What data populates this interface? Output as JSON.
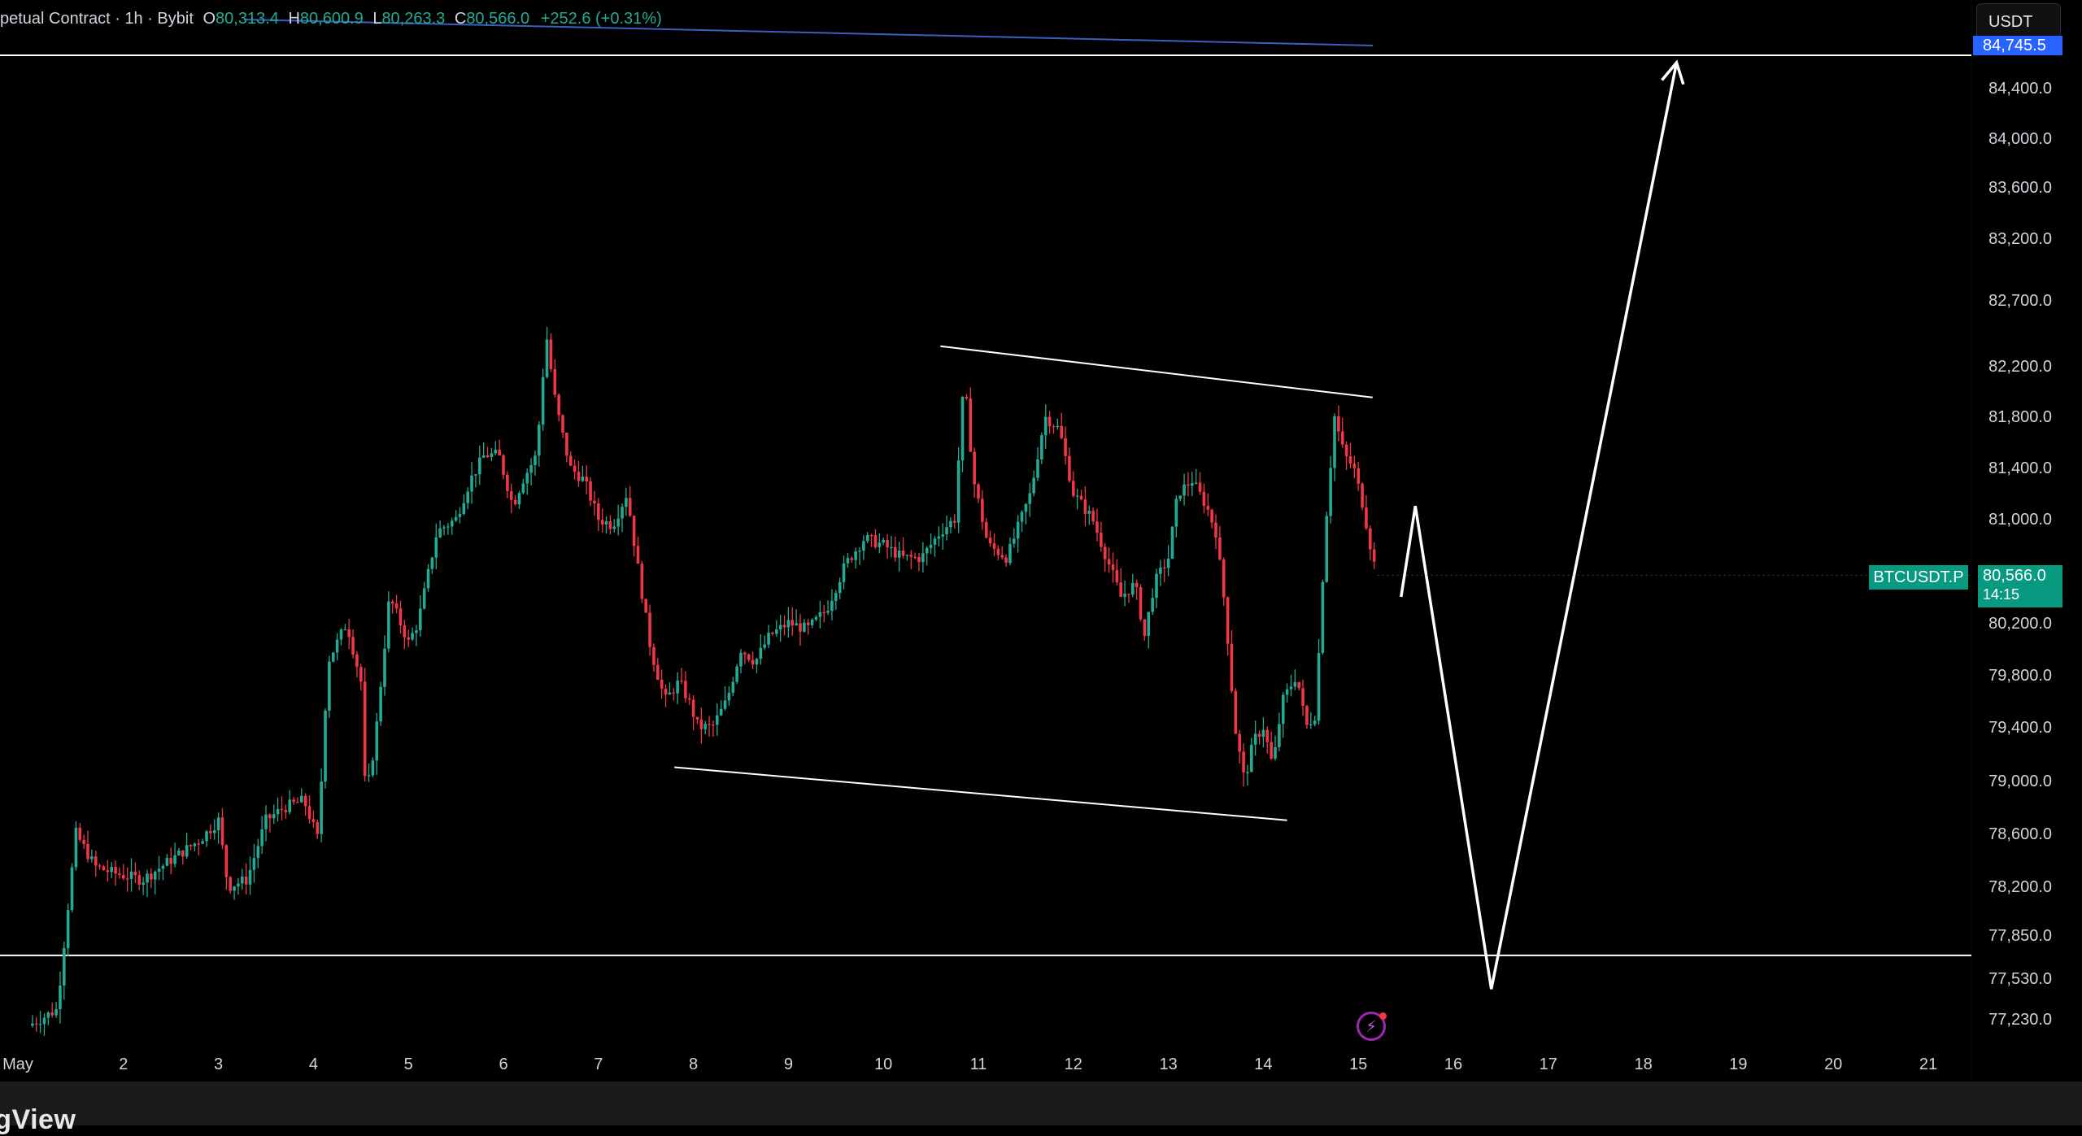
{
  "header": {
    "symbol_text": "petual Contract · 1h · Bybit",
    "open_label": "O",
    "open": "80,313.4",
    "high_label": "H",
    "high": "80,600.9",
    "low_label": "L",
    "low": "80,263.3",
    "close_label": "C",
    "close": "80,566.0",
    "change": "+252.6 (+0.31%)"
  },
  "unit_button": "USDT",
  "symbol_tag": "BTCUSDT.P",
  "last_price": "80,566.0",
  "countdown": "14:15",
  "top_price_tag": "84,745.5",
  "brand": "ngView",
  "colors": {
    "background": "#000000",
    "up": "#22ab94",
    "down": "#f23645",
    "drawing": "#ffffff",
    "ma_line": "#3a5fbf",
    "price_tag": "#089981",
    "alert_tag": "#2962ff"
  },
  "icons": {
    "alert": "lightning-bolt-icon"
  },
  "chart_data": {
    "type": "candlestick",
    "interval": "1h",
    "title": "",
    "xlabel": "",
    "ylabel": "",
    "x_ticks": [
      "May",
      "2",
      "3",
      "4",
      "5",
      "6",
      "7",
      "8",
      "9",
      "10",
      "11",
      "12",
      "13",
      "14",
      "15",
      "16",
      "17",
      "18",
      "19",
      "20",
      "21"
    ],
    "y_ticks": [
      84400,
      84000,
      83600,
      83200,
      82700,
      82200,
      81800,
      81400,
      81000,
      80200,
      79800,
      79400,
      79000,
      78600,
      78200,
      77850,
      77530,
      77230
    ],
    "y_tick_labels": [
      "84,400.0",
      "84,000.0",
      "83,600.0",
      "83,200.0",
      "82,700.0",
      "82,200.0",
      "81,800.0",
      "81,400.0",
      "81,000.0",
      "80,200.0",
      "79,800.0",
      "79,400.0",
      "79,000.0",
      "78,600.0",
      "78,200.0",
      "77,850.0",
      "77,530.0",
      "77,230.0"
    ],
    "ylim": [
      77000,
      84800
    ],
    "price_path": [
      [
        1.0,
        77180
      ],
      [
        1.3,
        77300
      ],
      [
        1.5,
        78600
      ],
      [
        1.7,
        78350
      ],
      [
        1.9,
        78300
      ],
      [
        2.2,
        78250
      ],
      [
        2.5,
        78400
      ],
      [
        2.8,
        78550
      ],
      [
        3.0,
        78700
      ],
      [
        3.1,
        78200
      ],
      [
        3.3,
        78250
      ],
      [
        3.5,
        78700
      ],
      [
        3.7,
        78800
      ],
      [
        3.9,
        78850
      ],
      [
        4.05,
        78550
      ],
      [
        4.15,
        79900
      ],
      [
        4.35,
        80200
      ],
      [
        4.5,
        79750
      ],
      [
        4.55,
        78850
      ],
      [
        4.65,
        79300
      ],
      [
        4.8,
        80400
      ],
      [
        5.0,
        80050
      ],
      [
        5.1,
        80200
      ],
      [
        5.3,
        80900
      ],
      [
        5.5,
        81000
      ],
      [
        5.65,
        81300
      ],
      [
        5.8,
        81500
      ],
      [
        5.95,
        81500
      ],
      [
        6.1,
        81100
      ],
      [
        6.2,
        81300
      ],
      [
        6.35,
        81500
      ],
      [
        6.45,
        82450
      ],
      [
        6.55,
        81900
      ],
      [
        6.7,
        81400
      ],
      [
        6.85,
        81300
      ],
      [
        7.0,
        81000
      ],
      [
        7.15,
        80950
      ],
      [
        7.3,
        81200
      ],
      [
        7.4,
        80700
      ],
      [
        7.55,
        80000
      ],
      [
        7.7,
        79600
      ],
      [
        7.85,
        79750
      ],
      [
        7.95,
        79600
      ],
      [
        8.05,
        79400
      ],
      [
        8.2,
        79400
      ],
      [
        8.35,
        79600
      ],
      [
        8.5,
        80000
      ],
      [
        8.65,
        79900
      ],
      [
        8.8,
        80100
      ],
      [
        9.0,
        80200
      ],
      [
        9.2,
        80150
      ],
      [
        9.4,
        80300
      ],
      [
        9.6,
        80650
      ],
      [
        9.8,
        80850
      ],
      [
        10.0,
        80800
      ],
      [
        10.2,
        80700
      ],
      [
        10.4,
        80700
      ],
      [
        10.6,
        80900
      ],
      [
        10.75,
        81000
      ],
      [
        10.85,
        82100
      ],
      [
        10.95,
        81300
      ],
      [
        11.1,
        80800
      ],
      [
        11.3,
        80700
      ],
      [
        11.45,
        81000
      ],
      [
        11.55,
        81200
      ],
      [
        11.7,
        81800
      ],
      [
        11.85,
        81700
      ],
      [
        12.0,
        81200
      ],
      [
        12.2,
        81000
      ],
      [
        12.35,
        80700
      ],
      [
        12.5,
        80400
      ],
      [
        12.65,
        80500
      ],
      [
        12.75,
        80100
      ],
      [
        12.85,
        80500
      ],
      [
        13.0,
        80700
      ],
      [
        13.1,
        81200
      ],
      [
        13.25,
        81300
      ],
      [
        13.4,
        81100
      ],
      [
        13.5,
        80900
      ],
      [
        13.6,
        80300
      ],
      [
        13.7,
        79400
      ],
      [
        13.8,
        79000
      ],
      [
        13.9,
        79300
      ],
      [
        14.0,
        79400
      ],
      [
        14.1,
        79100
      ],
      [
        14.2,
        79600
      ],
      [
        14.35,
        79800
      ],
      [
        14.45,
        79400
      ],
      [
        14.55,
        79500
      ],
      [
        14.65,
        80900
      ],
      [
        14.75,
        81800
      ],
      [
        14.85,
        81500
      ],
      [
        14.95,
        81400
      ],
      [
        15.05,
        81100
      ],
      [
        15.15,
        80700
      ],
      [
        15.2,
        80566
      ]
    ],
    "horizontal_lines": [
      84745.5,
      77700
    ],
    "channel_top": [
      [
        10.6,
        82350
      ],
      [
        15.15,
        81950
      ]
    ],
    "channel_bottom": [
      [
        7.8,
        79100
      ],
      [
        14.25,
        78700
      ]
    ],
    "projection_path": [
      [
        15.45,
        80400
      ],
      [
        15.6,
        81100
      ],
      [
        16.4,
        77450
      ],
      [
        18.35,
        84600
      ]
    ]
  }
}
